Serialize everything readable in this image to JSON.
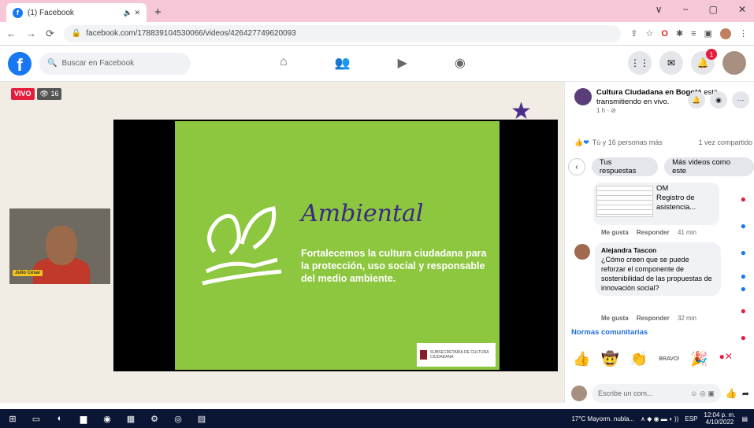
{
  "browser": {
    "tab_title": "(1) Facebook",
    "tab_icons": "🔈 ✕",
    "new_tab": "+",
    "win_controls": [
      "∨",
      "−",
      "▢",
      "✕"
    ],
    "url": "facebook.com/178839104530066/videos/426427749620093"
  },
  "fb": {
    "search_placeholder": "Buscar en Facebook",
    "notif_count": "1"
  },
  "video": {
    "live_label": "VIVO",
    "viewers": "👁 16",
    "slide_title": "Ambiental",
    "slide_text": "Fortalecemos la cultura ciudadana para la protección, uso social y responsable del medio ambiente.",
    "slide_logo_text": "SUBSECRETARÍA DE CULTURA CIUDADANA",
    "cam_label": "Julio César"
  },
  "sidebar": {
    "page_name": "Cultura Ciudadana en Bogotá",
    "page_status": "está transmitiendo en vivo.",
    "page_time": "1 h · ⊘",
    "reactions_text": "Tú y 16 personas más",
    "shares": "1 vez compartido",
    "chip_1": "Tus respuestas",
    "chip_2": "Más videos como este",
    "doc_title": "OM",
    "doc_name": "Registro de asistencia...",
    "c1_like": "Me gusta",
    "c1_reply": "Responder",
    "c1_time": "41 min",
    "c2_author": "Alejandra Tascon",
    "c2_text": "¿Cómo creen que se puede reforzar el componente de sostenibilidad de las propuestas de innovación social?",
    "c2_like": "Me gusta",
    "c2_reply": "Responder",
    "c2_time": "32 min",
    "normas": "Normas comunitarias",
    "sticker_text": "BRAVO!",
    "compose_placeholder": "Escribe un com..."
  },
  "taskbar": {
    "weather": "17°C  Mayorm. nubla...",
    "lang": "ESP",
    "time": "12:04 p. m.",
    "date": "4/10/2022"
  }
}
